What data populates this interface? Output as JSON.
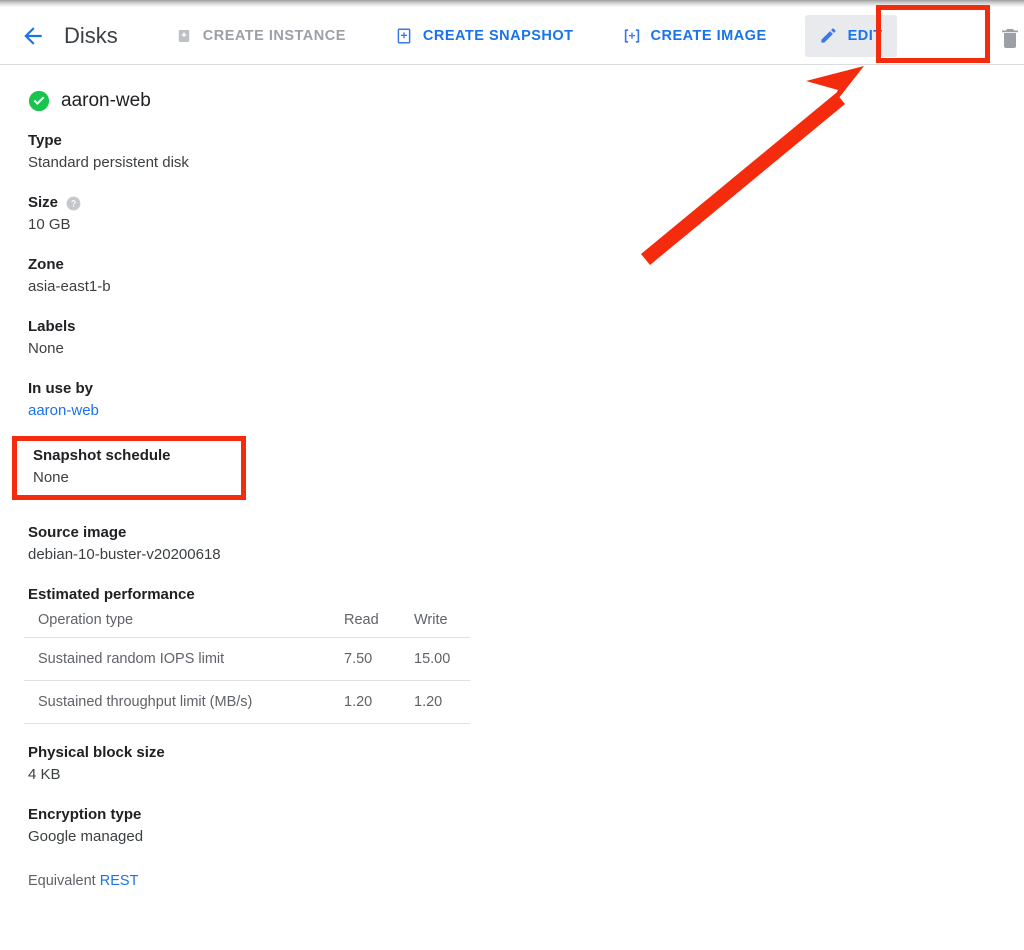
{
  "window": {
    "chrome_color": "#bdbdbd"
  },
  "toolbar": {
    "back_label": "back-arrow",
    "title": "Disks",
    "actions": [
      {
        "label": "CREATE INSTANCE",
        "icon": "create-instance-icon",
        "state": "disabled"
      },
      {
        "label": "CREATE SNAPSHOT",
        "icon": "create-snapshot-icon",
        "state": "enabled"
      },
      {
        "label": "CREATE IMAGE",
        "icon": "create-image-icon",
        "state": "enabled"
      },
      {
        "label": "EDIT",
        "icon": "pencil-icon",
        "state": "active"
      }
    ],
    "delete_icon": "trash-icon"
  },
  "highlights": {
    "edit_button": {
      "color": "#f42b0c",
      "target": "EDIT"
    },
    "snapshot_schedule": {
      "color": "#f42b0c",
      "target": "Snapshot schedule"
    },
    "arrow": {
      "color": "#f42b0c",
      "from": "snapshot-schedule-area",
      "to": "EDIT"
    }
  },
  "disk": {
    "status_icon": "status-ok-icon",
    "name": "aaron-web",
    "fields": [
      {
        "label": "Type",
        "value": "Standard persistent disk"
      },
      {
        "label": "Size",
        "value": "10 GB",
        "help": "help-icon"
      },
      {
        "label": "Zone",
        "value": "asia-east1-b"
      },
      {
        "label": "Labels",
        "value": "None"
      },
      {
        "label": "In use by",
        "value": "aaron-web",
        "is_link": true
      },
      {
        "label": "Snapshot schedule",
        "value": "None",
        "highlighted": true
      },
      {
        "label": "Source image",
        "value": "debian-10-buster-v20200618"
      }
    ],
    "performance": {
      "title": "Estimated performance",
      "columns": [
        "Operation type",
        "Read",
        "Write"
      ],
      "rows": [
        {
          "operation": "Sustained random IOPS limit",
          "read": "7.50",
          "write": "15.00"
        },
        {
          "operation": "Sustained throughput limit (MB/s)",
          "read": "1.20",
          "write": "1.20"
        }
      ]
    },
    "fields_after": [
      {
        "label": "Physical block size",
        "value": "4 KB"
      },
      {
        "label": "Encryption type",
        "value": "Google managed"
      }
    ],
    "equivalent": {
      "prefix": "Equivalent ",
      "link": "REST"
    }
  }
}
